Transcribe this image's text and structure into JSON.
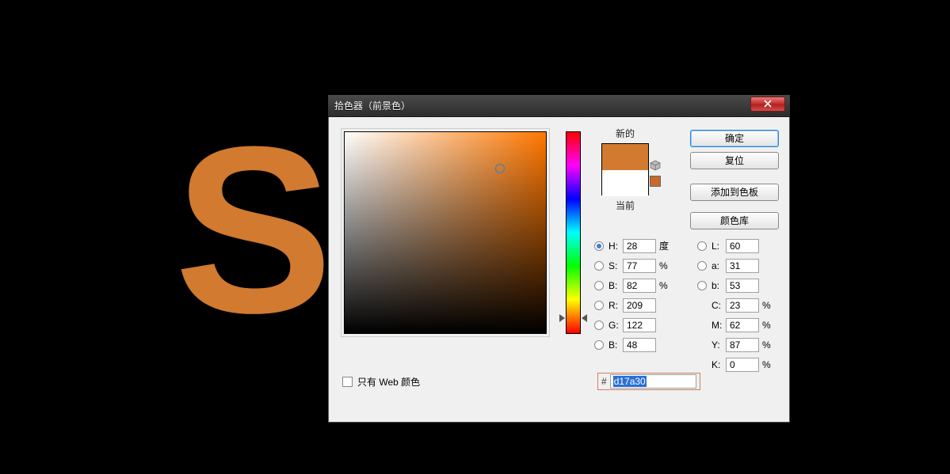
{
  "canvas": {
    "letter": "S",
    "color": "#d17a30"
  },
  "dialog": {
    "title": "拾色器（前景色）",
    "buttons": {
      "ok": "确定",
      "cancel": "复位",
      "add": "添加到色板",
      "lib": "颜色库"
    },
    "swatch": {
      "new_label": "新的",
      "current_label": "当前",
      "new_color": "#d17a30",
      "oog_color": "#c86a2a"
    },
    "picker": {
      "cursor_left_pct": 77,
      "cursor_top_pct": 18,
      "hue_top_pct": 92
    },
    "hsb": {
      "h": {
        "label": "H:",
        "value": "28",
        "unit": "度"
      },
      "s": {
        "label": "S:",
        "value": "77",
        "unit": "%"
      },
      "b": {
        "label": "B:",
        "value": "82",
        "unit": "%"
      }
    },
    "rgb": {
      "r": {
        "label": "R:",
        "value": "209"
      },
      "g": {
        "label": "G:",
        "value": "122"
      },
      "b": {
        "label": "B:",
        "value": "48"
      }
    },
    "lab": {
      "l": {
        "label": "L:",
        "value": "60"
      },
      "a": {
        "label": "a:",
        "value": "31"
      },
      "b": {
        "label": "b:",
        "value": "53"
      }
    },
    "cmyk": {
      "c": {
        "label": "C:",
        "value": "23",
        "unit": "%"
      },
      "m": {
        "label": "M:",
        "value": "62",
        "unit": "%"
      },
      "y": {
        "label": "Y:",
        "value": "87",
        "unit": "%"
      },
      "k": {
        "label": "K:",
        "value": "0",
        "unit": "%"
      }
    },
    "hex": {
      "hash": "#",
      "value": "d17a30"
    },
    "web_only": {
      "label": "只有 Web 颜色",
      "checked": false
    }
  }
}
